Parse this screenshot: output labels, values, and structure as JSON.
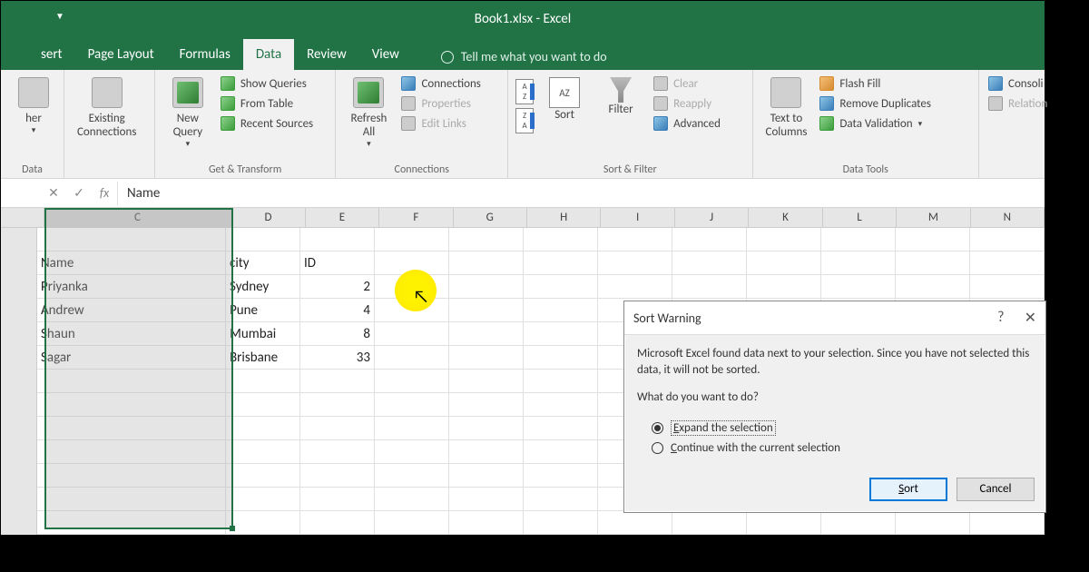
{
  "title": "Book1.xlsx - Excel",
  "tabs": {
    "insert": "sert",
    "pagelayout": "Page Layout",
    "formulas": "Formulas",
    "data": "Data",
    "review": "Review",
    "view": "View"
  },
  "tellme": "Tell me what you want to do",
  "ribbon": {
    "getdata_group": "Data",
    "other_btn": "her",
    "existing": "Existing\nConnections",
    "newquery": "New\nQuery",
    "showqueries": "Show Queries",
    "fromtable": "From Table",
    "recentsources": "Recent Sources",
    "gettransform": "Get & Transform",
    "refreshall": "Refresh\nAll",
    "connections": "Connections",
    "properties": "Properties",
    "editlinks": "Edit Links",
    "conn_group": "Connections",
    "sort": "Sort",
    "filter": "Filter",
    "clear": "Clear",
    "reapply": "Reapply",
    "advanced": "Advanced",
    "sortfilter_group": "Sort & Filter",
    "texttocol": "Text to\nColumns",
    "flashfill": "Flash Fill",
    "removedup": "Remove Duplicates",
    "datavalid": "Data Validation",
    "consolidate": "Consoli",
    "relations": "Relation",
    "datatools": "Data Tools"
  },
  "formula": "Name",
  "columns": [
    "C",
    "D",
    "E",
    "F",
    "G",
    "H",
    "I",
    "J",
    "K",
    "L",
    "M",
    "N"
  ],
  "headers": {
    "c": "Name",
    "d": "city",
    "e": "ID"
  },
  "rows": [
    {
      "c": "Priyanka",
      "d": "Sydney",
      "e": "2"
    },
    {
      "c": "Andrew",
      "d": "Pune",
      "e": "4"
    },
    {
      "c": "Shaun",
      "d": "Mumbai",
      "e": "8"
    },
    {
      "c": "Sagar",
      "d": "Brisbane",
      "e": "33"
    }
  ],
  "dialog": {
    "title": "Sort Warning",
    "msg": "Microsoft Excel found data next to your selection.  Since you have not selected this data, it will not be sorted.",
    "q": "What do you want to do?",
    "opt1": "Expand the selection",
    "opt2": "Continue with the current selection",
    "sort": "Sort",
    "cancel": "Cancel",
    "help": "?",
    "close": "✕"
  }
}
